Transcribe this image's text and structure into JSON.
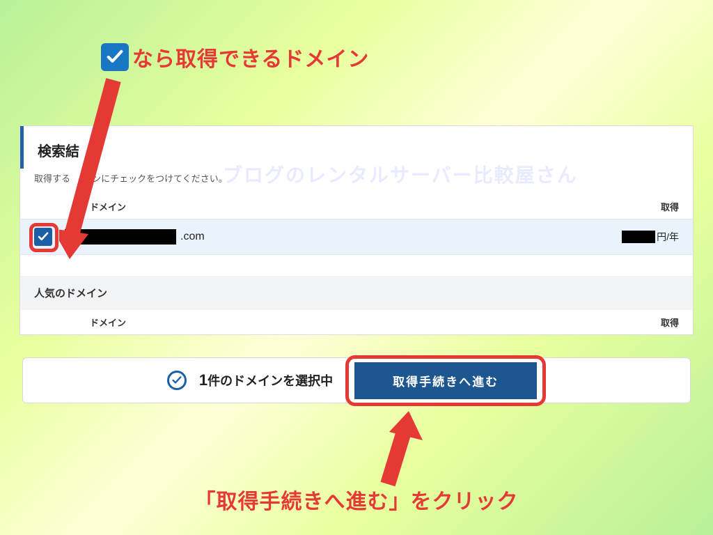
{
  "annotations": {
    "top": "なら取得できるドメイン",
    "bottom": "「取得手続きへ進む」をクリック"
  },
  "watermark": "ブログのレンタルサーバー比較屋さん",
  "section": {
    "title": "検索結",
    "instruction_prefix": "取得する",
    "instruction_suffix": "インにチェックをつけてください。"
  },
  "table": {
    "header_domain": "ドメイン",
    "header_get": "取得",
    "row_domain_suffix": ".com",
    "row_price_suffix": "円/年"
  },
  "popular": {
    "title": "人気のドメイン",
    "header_domain": "ドメイン",
    "header_get": "取得"
  },
  "footer": {
    "count": "1",
    "selected_text": "件のドメインを選択中",
    "proceed_label": "取得手続きへ進む"
  }
}
